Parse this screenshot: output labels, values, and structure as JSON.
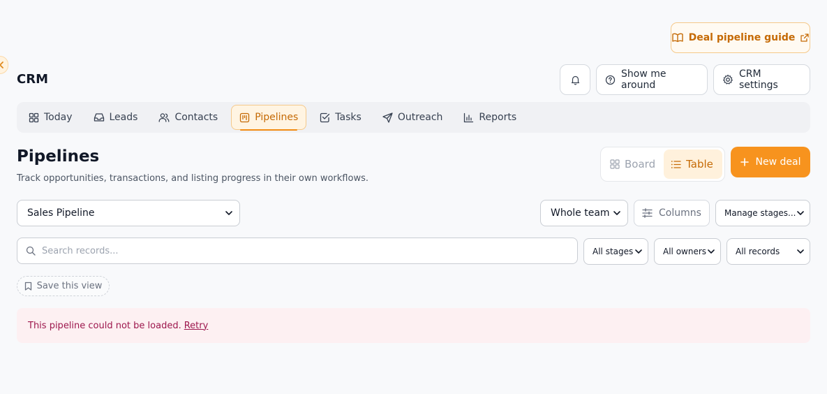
{
  "guide": {
    "label": "Deal pipeline guide"
  },
  "app": {
    "title": "CRM"
  },
  "top_actions": {
    "show_around_label": "Show me around",
    "settings_label": "CRM settings"
  },
  "nav": {
    "items": [
      {
        "label": "Today",
        "icon": "grid-icon"
      },
      {
        "label": "Leads",
        "icon": "inbox-icon"
      },
      {
        "label": "Contacts",
        "icon": "users-icon"
      },
      {
        "label": "Pipelines",
        "icon": "kanban-icon",
        "active": true
      },
      {
        "label": "Tasks",
        "icon": "check-square-icon"
      },
      {
        "label": "Outreach",
        "icon": "send-icon"
      },
      {
        "label": "Reports",
        "icon": "bar-chart-icon"
      }
    ]
  },
  "page": {
    "title": "Pipelines",
    "subtitle": "Track opportunities, transactions, and listing progress in their own workflows."
  },
  "view_toggle": {
    "board_label": "Board",
    "table_label": "Table",
    "selected": "Table"
  },
  "new_deal": {
    "label": "New deal"
  },
  "filters": {
    "pipeline": "Sales Pipeline",
    "team": "Whole team",
    "columns_label": "Columns",
    "manage_stages": "Manage stages...",
    "stages": "All stages",
    "owners": "All owners",
    "records": "All records"
  },
  "search": {
    "placeholder": "Search records..."
  },
  "save_view": {
    "label": "Save this view"
  },
  "error": {
    "message": "This pipeline could not be loaded.",
    "retry_label": "Retry"
  },
  "colors": {
    "accent": "#f7931e",
    "accent_text": "#c56a05",
    "error_bg": "#fdf0f2",
    "error_text": "#9d174d"
  }
}
